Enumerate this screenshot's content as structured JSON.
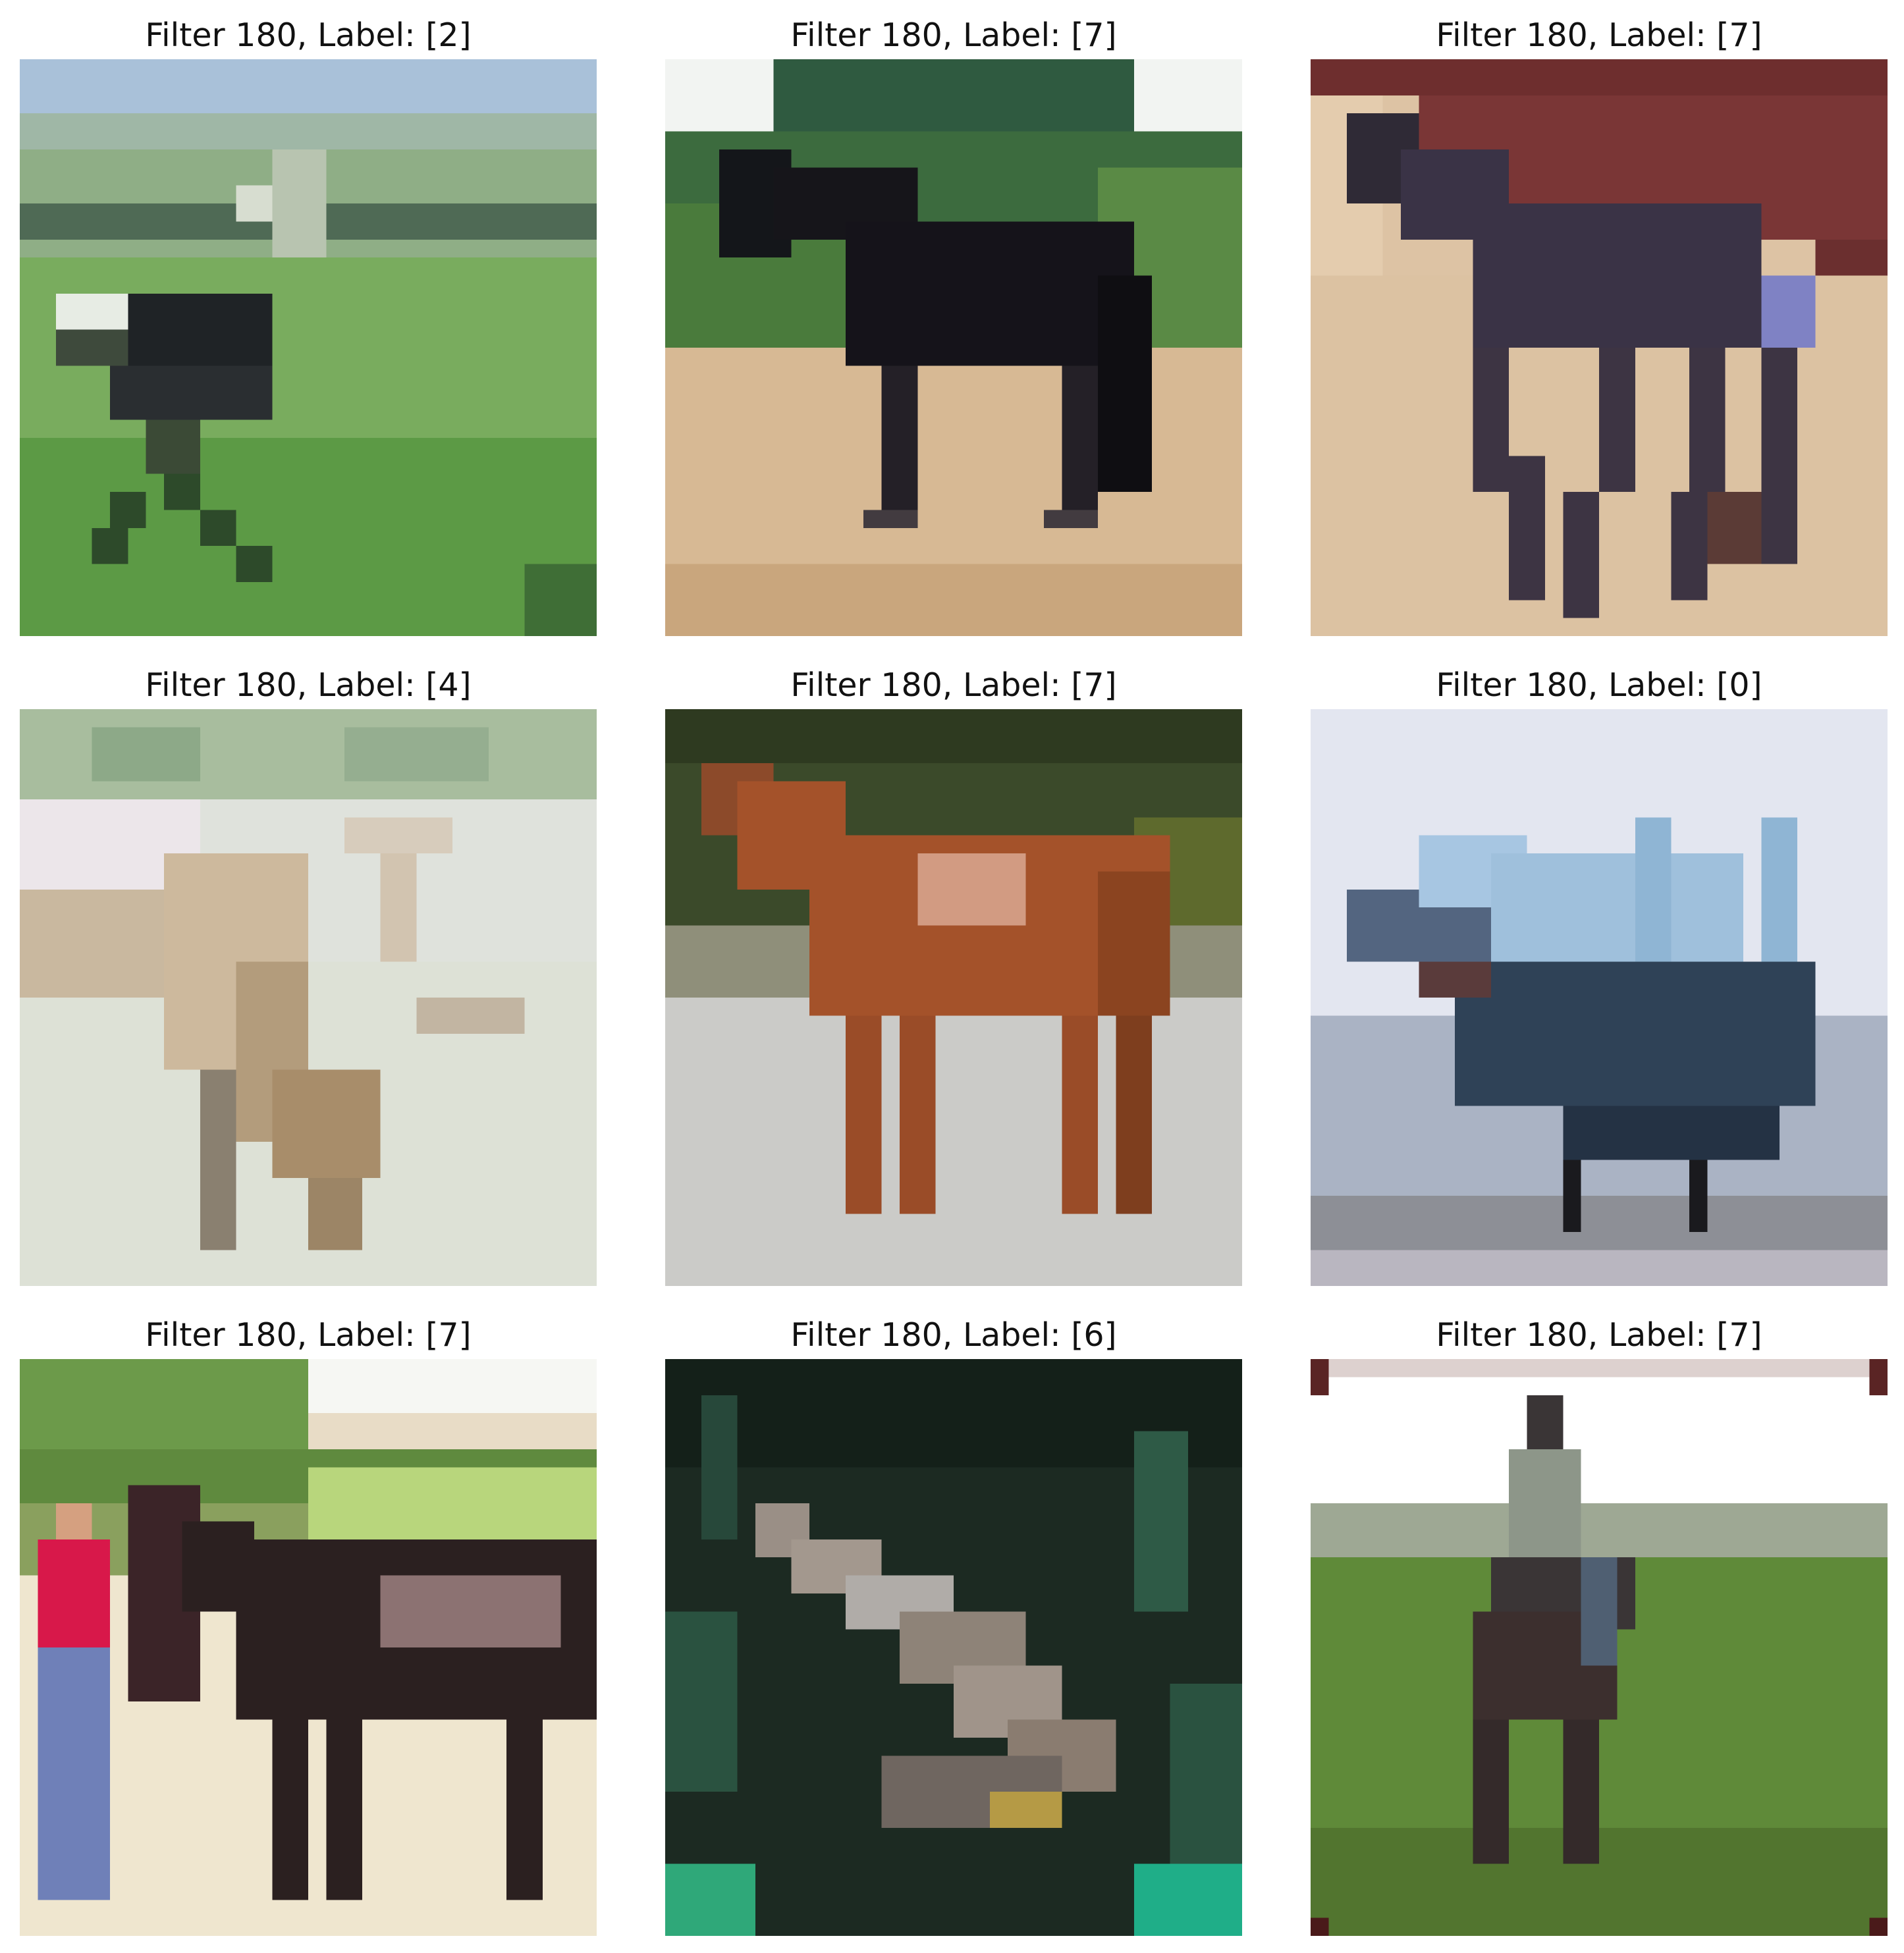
{
  "panels": [
    {
      "title": "Filter 180, Label: [2]",
      "scene": "ostrich-grass",
      "colors": {
        "sky": "#a9c1d9",
        "ground": "#6aa54e",
        "subject": "#22262a"
      }
    },
    {
      "title": "Filter 180, Label: [7]",
      "scene": "black-horse",
      "colors": {
        "sky": "#f2f4f2",
        "ground": "#d8bb98",
        "subject": "#15131a"
      }
    },
    {
      "title": "Filter 180, Label: [7]",
      "scene": "dark-horse-walking",
      "colors": {
        "sky": "#6e2e2e",
        "ground": "#ddc3a4",
        "subject": "#3a3346"
      }
    },
    {
      "title": "Filter 180, Label: [4]",
      "scene": "pale-deer",
      "colors": {
        "sky": "#a8bd9e",
        "ground": "#dfe2dc",
        "subject": "#c9b89f"
      }
    },
    {
      "title": "Filter 180, Label: [7]",
      "scene": "chestnut-horse",
      "colors": {
        "sky": "#3b4a2a",
        "ground": "#cfcfcc",
        "subject": "#a4522a"
      }
    },
    {
      "title": "Filter 180, Label: [0]",
      "scene": "fighter-jet",
      "colors": {
        "sky": "#e3e6f0",
        "ground": "#8d8f96",
        "subject": "#2f4257"
      }
    },
    {
      "title": "Filter 180, Label: [7]",
      "scene": "horse-and-person",
      "colors": {
        "sky": "#f6f7f3",
        "ground": "#e8dcc6",
        "subject": "#2b2020"
      }
    },
    {
      "title": "Filter 180, Label: [6]",
      "scene": "frog-foliage",
      "colors": {
        "sky": "#1c2a22",
        "ground": "#27483a",
        "subject": "#9a8f86"
      }
    },
    {
      "title": "Filter 180, Label: [7]",
      "scene": "rider-on-horse",
      "colors": {
        "sky": "#ffffff",
        "ground": "#5f8a39",
        "subject": "#3a3536"
      }
    }
  ]
}
